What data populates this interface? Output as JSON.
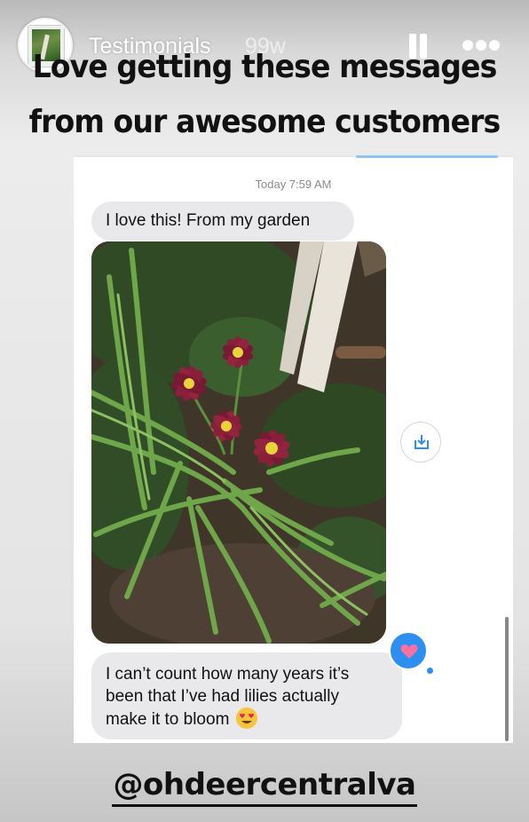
{
  "header": {
    "account_name": "Testimonials",
    "time_ago": "99w",
    "pause_icon": "pause-icon",
    "more_icon": "more-options-icon"
  },
  "caption": {
    "line1": "Love getting these messages",
    "line2": "from our awesome customers"
  },
  "conversation": {
    "timestamp": "Today 7:59 AM",
    "message1": "I love this! From my garden",
    "message2_line1": "I can’t count how many years it’s",
    "message2_line2": "been that I’ve had lilies actually",
    "message2_line3": "make it to bloom",
    "emoji": "heart-eyes-emoji",
    "reaction": "heart-reaction-icon",
    "download_icon": "download-icon",
    "photo_subject": "daylilies-photo"
  },
  "footer": {
    "mention": "@ohdeercentralva"
  },
  "colors": {
    "bubble": "#e9e9eb",
    "reaction_blue": "#2d8ff0",
    "lily": "#8a1f3c"
  }
}
